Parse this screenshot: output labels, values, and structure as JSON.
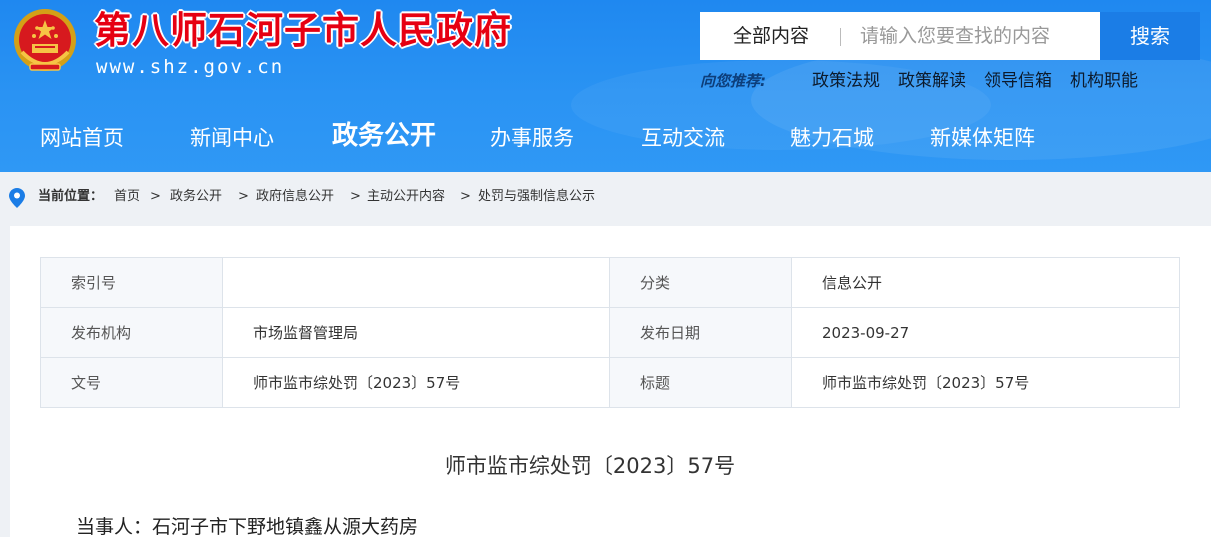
{
  "header": {
    "site_title": "第八师石河子市人民政府",
    "site_url": "www.shz.gov.cn",
    "emblem_icon": "national-emblem-icon"
  },
  "search": {
    "scope": "全部内容",
    "placeholder": "请输入您要查找的内容",
    "button": "搜索"
  },
  "recommend": {
    "label": "向您推荐:",
    "links": [
      "政策法规",
      "政策解读",
      "领导信箱",
      "机构职能"
    ]
  },
  "nav": {
    "items": [
      "网站首页",
      "新闻中心",
      "政务公开",
      "办事服务",
      "互动交流",
      "魅力石城",
      "新媒体矩阵"
    ],
    "active": "政务公开"
  },
  "breadcrumb": {
    "label": "当前位置：",
    "items": [
      "首页",
      "政务公开",
      "政府信息公开",
      "主动公开内容",
      "处罚与强制信息公示"
    ],
    "separator": ">"
  },
  "meta": {
    "rows": [
      {
        "k1": "索引号",
        "v1": "",
        "k2": "分类",
        "v2": "信息公开"
      },
      {
        "k1": "发布机构",
        "v1": "市场监督管理局",
        "k2": "发布日期",
        "v2": "2023-09-27"
      },
      {
        "k1": "文号",
        "v1": "师市监市综处罚〔2023〕57号",
        "k2": "标题",
        "v2": "师市监市综处罚〔2023〕57号"
      }
    ]
  },
  "document": {
    "title": "师市监市综处罚〔2023〕57号",
    "party": "当事人：石河子市下野地镇鑫从源大药房"
  },
  "colors": {
    "header_blue": "#2a93f3",
    "search_button": "#1b7de6",
    "title_red": "#e60012"
  }
}
